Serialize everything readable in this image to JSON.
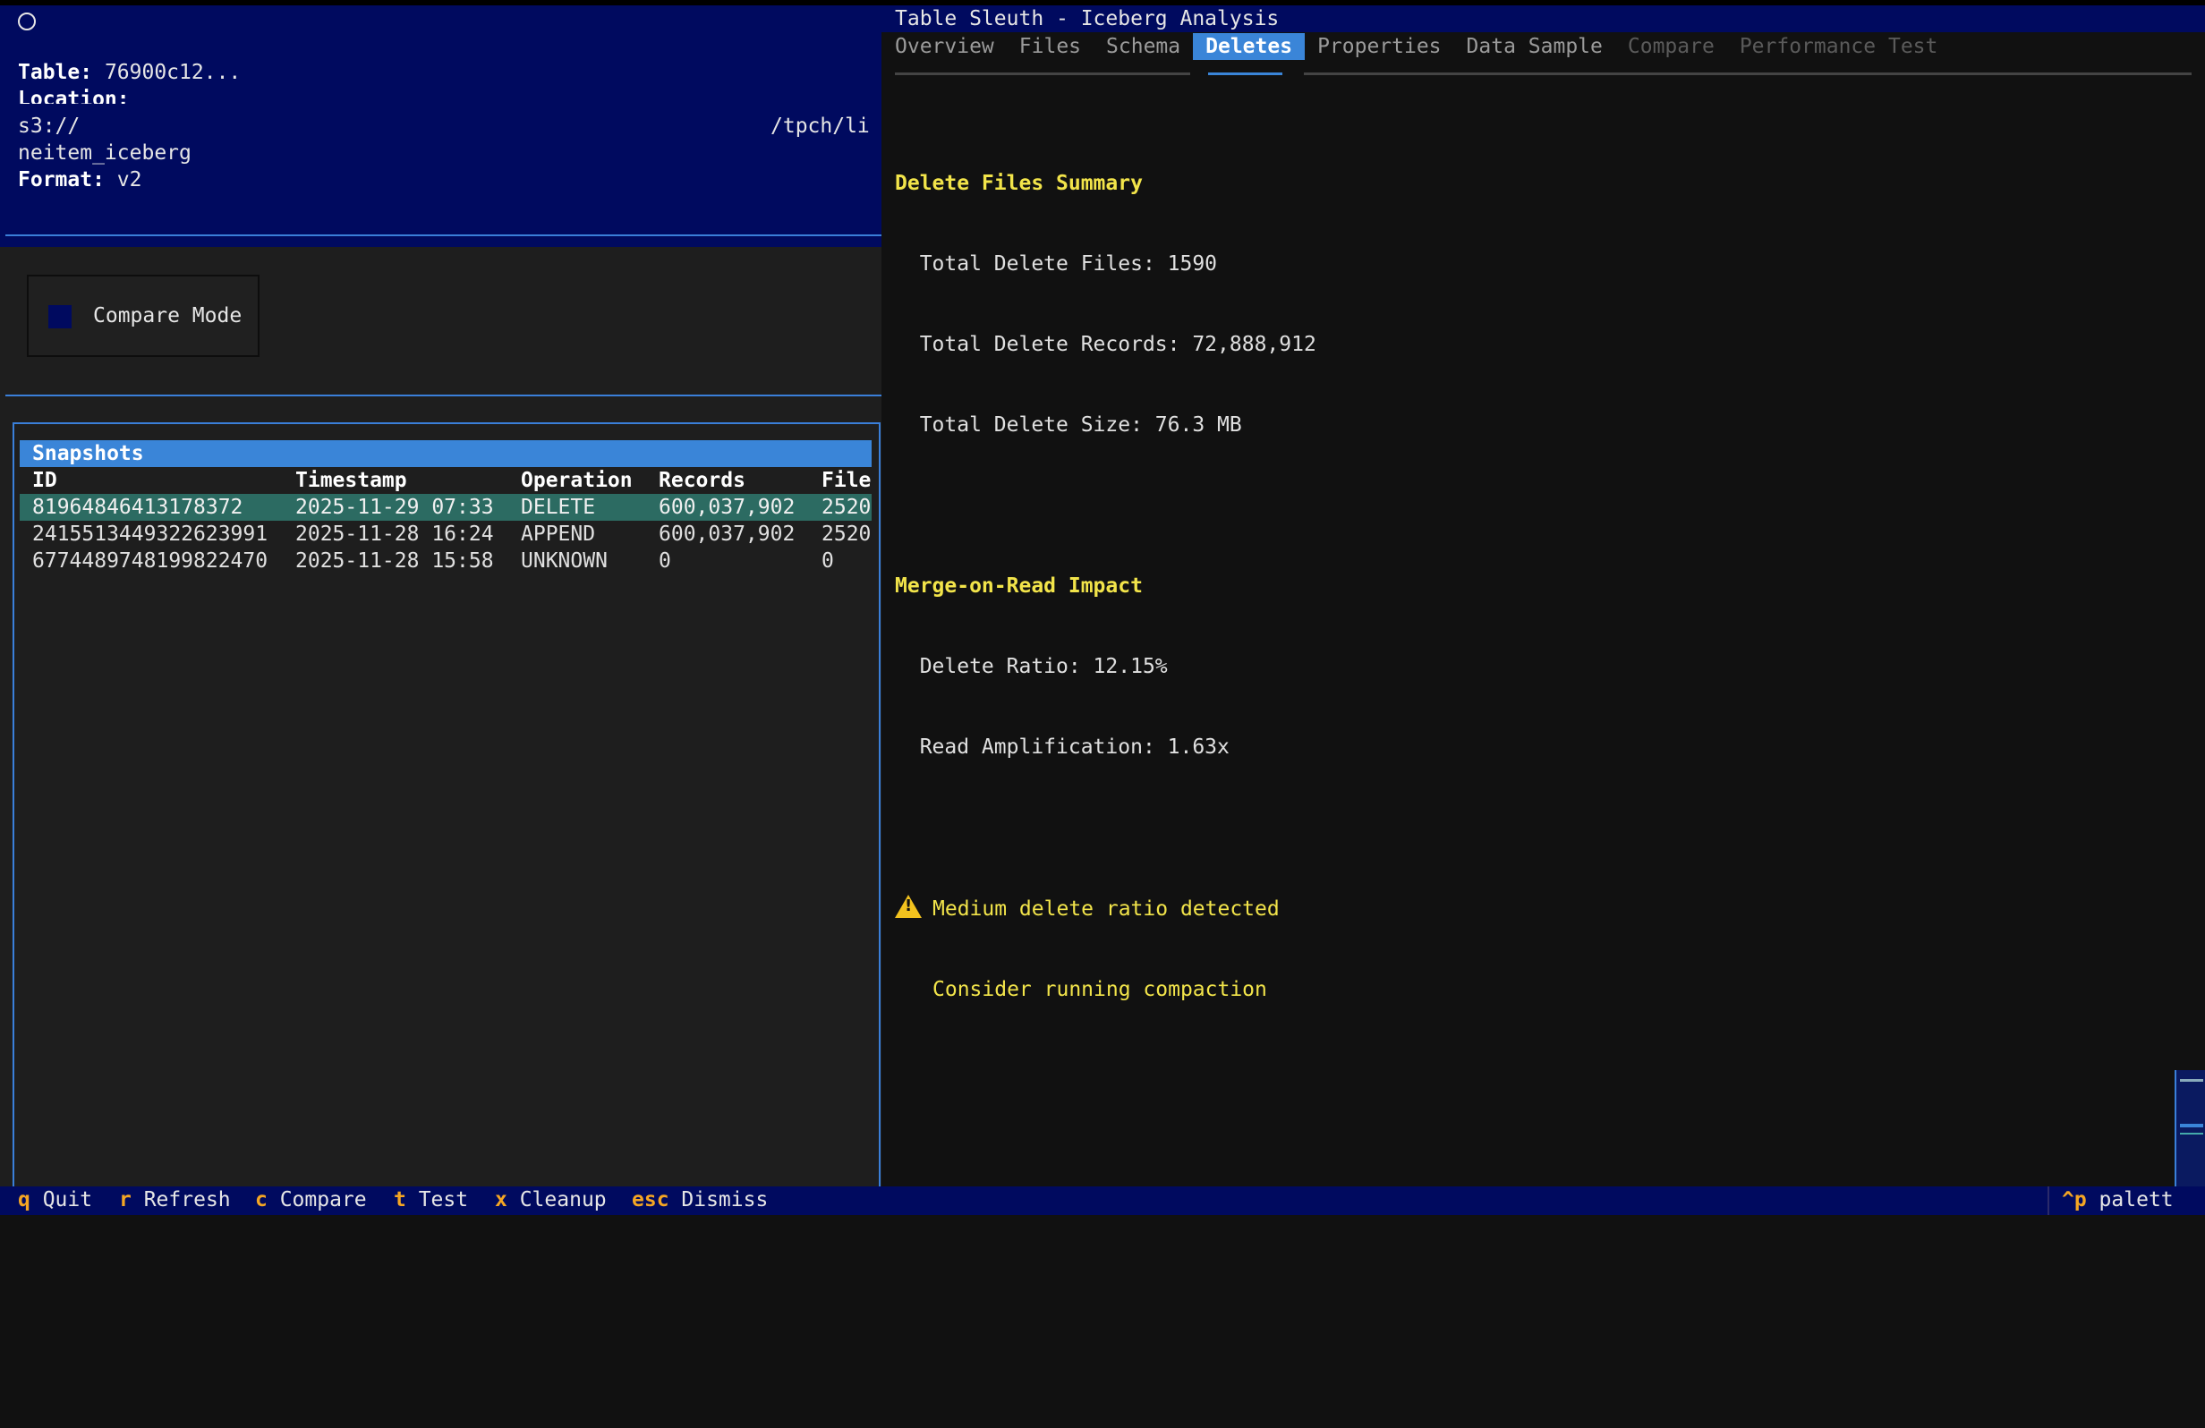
{
  "app": {
    "title": "Table Sleuth - Iceberg Analysis"
  },
  "info": {
    "table_label": "Table:",
    "table_value": " 76900c12...",
    "location_label": "Location:",
    "location_line1_a": "s3://",
    "location_line1_b": "/tpch/li",
    "location_line2": "neitem_iceberg",
    "format_label": "Format:",
    "format_value": " v2"
  },
  "compare_mode": {
    "label": "Compare Mode",
    "checked": false
  },
  "snapshots": {
    "title": "Snapshots",
    "columns": [
      "ID",
      "Timestamp",
      "Operation",
      "Records",
      "File"
    ],
    "rows": [
      {
        "id": "81964846413178372",
        "timestamp": "2025-11-29 07:33",
        "operation": "DELETE",
        "records": "600,037,902",
        "files": "2520"
      },
      {
        "id": "2415513449322623991",
        "timestamp": "2025-11-28 16:24",
        "operation": "APPEND",
        "records": "600,037,902",
        "files": "2520"
      },
      {
        "id": "6774489748199822470",
        "timestamp": "2025-11-28 15:58",
        "operation": "UNKNOWN",
        "records": "0",
        "files": "0"
      }
    ]
  },
  "tabs": [
    {
      "label": "Overview",
      "state": "normal"
    },
    {
      "label": "Files",
      "state": "normal"
    },
    {
      "label": "Schema",
      "state": "normal"
    },
    {
      "label": "Deletes",
      "state": "active"
    },
    {
      "label": "Properties",
      "state": "normal"
    },
    {
      "label": "Data Sample",
      "state": "normal"
    },
    {
      "label": "Compare",
      "state": "disabled"
    },
    {
      "label": "Performance Test",
      "state": "disabled"
    }
  ],
  "deletes": {
    "summary_heading": "Delete Files Summary",
    "total_files": "  Total Delete Files: 1590",
    "total_records": "  Total Delete Records: 72,888,912",
    "total_size": "  Total Delete Size: 76.3 MB",
    "impact_heading": "Merge-on-Read Impact",
    "delete_ratio": "  Delete Ratio: 12.15%",
    "read_amp": "  Read Amplification: 1.63x",
    "warning_line1": "Medium delete ratio detected",
    "warning_line2": "Consider running compaction",
    "warning_icon": "warning-triangle-icon"
  },
  "footer": {
    "items": [
      {
        "key": "q",
        "label": " Quit"
      },
      {
        "key": "r",
        "label": " Refresh"
      },
      {
        "key": "c",
        "label": " Compare"
      },
      {
        "key": "t",
        "label": " Test"
      },
      {
        "key": "x",
        "label": " Cleanup"
      },
      {
        "key": "esc",
        "label": " Dismiss"
      }
    ],
    "palette_key": "^p",
    "palette_label": " palett"
  },
  "colors": {
    "panel_blue": "#000a5f",
    "accent_blue": "#3a85d8",
    "heading_yellow": "#f2e44a",
    "key_orange": "#f5a623",
    "selected_row": "#2c6b62"
  }
}
